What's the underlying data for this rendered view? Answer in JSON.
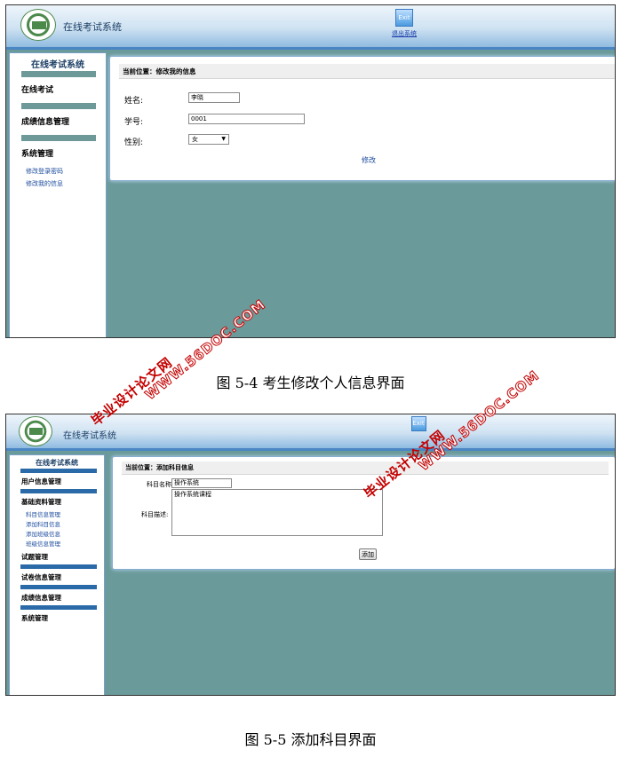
{
  "screens": [
    {
      "header": {
        "title": "在线考试系统",
        "exit_label": "退出系统",
        "exit_icon": "exit-icon"
      },
      "sidebar": {
        "heading": "在线考试系统",
        "groups": [
          {
            "label": "在线考试",
            "links": []
          },
          {
            "label": "成绩信息管理",
            "links": []
          },
          {
            "label": "系统管理",
            "links": [
              "修改登录密码",
              "修改我的信息"
            ]
          }
        ]
      },
      "main": {
        "breadcrumb": "当前位置：修改我的信息",
        "form": {
          "name_label": "姓名:",
          "name_value": "李晓",
          "id_label": "学号:",
          "id_value": "0001",
          "gender_label": "性别:",
          "gender_value": "女",
          "submit_label": "修改"
        }
      }
    },
    {
      "header": {
        "title": "在线考试系统",
        "exit_icon": "exit-icon"
      },
      "sidebar": {
        "heading": "在线考试系统",
        "groups": [
          {
            "label": "用户信息管理",
            "links": []
          },
          {
            "label": "基础资料管理",
            "links": [
              "科目信息管理",
              "添加科目信息",
              "添加班级信息",
              "班级信息管理"
            ]
          },
          {
            "label": "试题管理",
            "links": []
          },
          {
            "label": "试卷信息管理",
            "links": []
          },
          {
            "label": "成绩信息管理",
            "links": []
          },
          {
            "label": "系统管理",
            "links": []
          }
        ]
      },
      "main": {
        "breadcrumb": "当前位置：添加科目信息",
        "form": {
          "subject_name_label": "科目名称:",
          "subject_name_value": "操作系统",
          "subject_desc_label": "科目描述:",
          "subject_desc_value": "操作系统课程",
          "add_button_label": "添加"
        }
      }
    }
  ],
  "captions": [
    "图 5-4 考生修改个人信息界面",
    "图 5-5 添加科目界面"
  ],
  "watermarks": [
    "毕业设计论文网",
    "WWW.56DOC.COM"
  ],
  "colors": {
    "content_bg": "#6a9a9a",
    "header_accent": "#4a86c4",
    "link": "#1a4a9c",
    "watermark": "#c40000"
  }
}
